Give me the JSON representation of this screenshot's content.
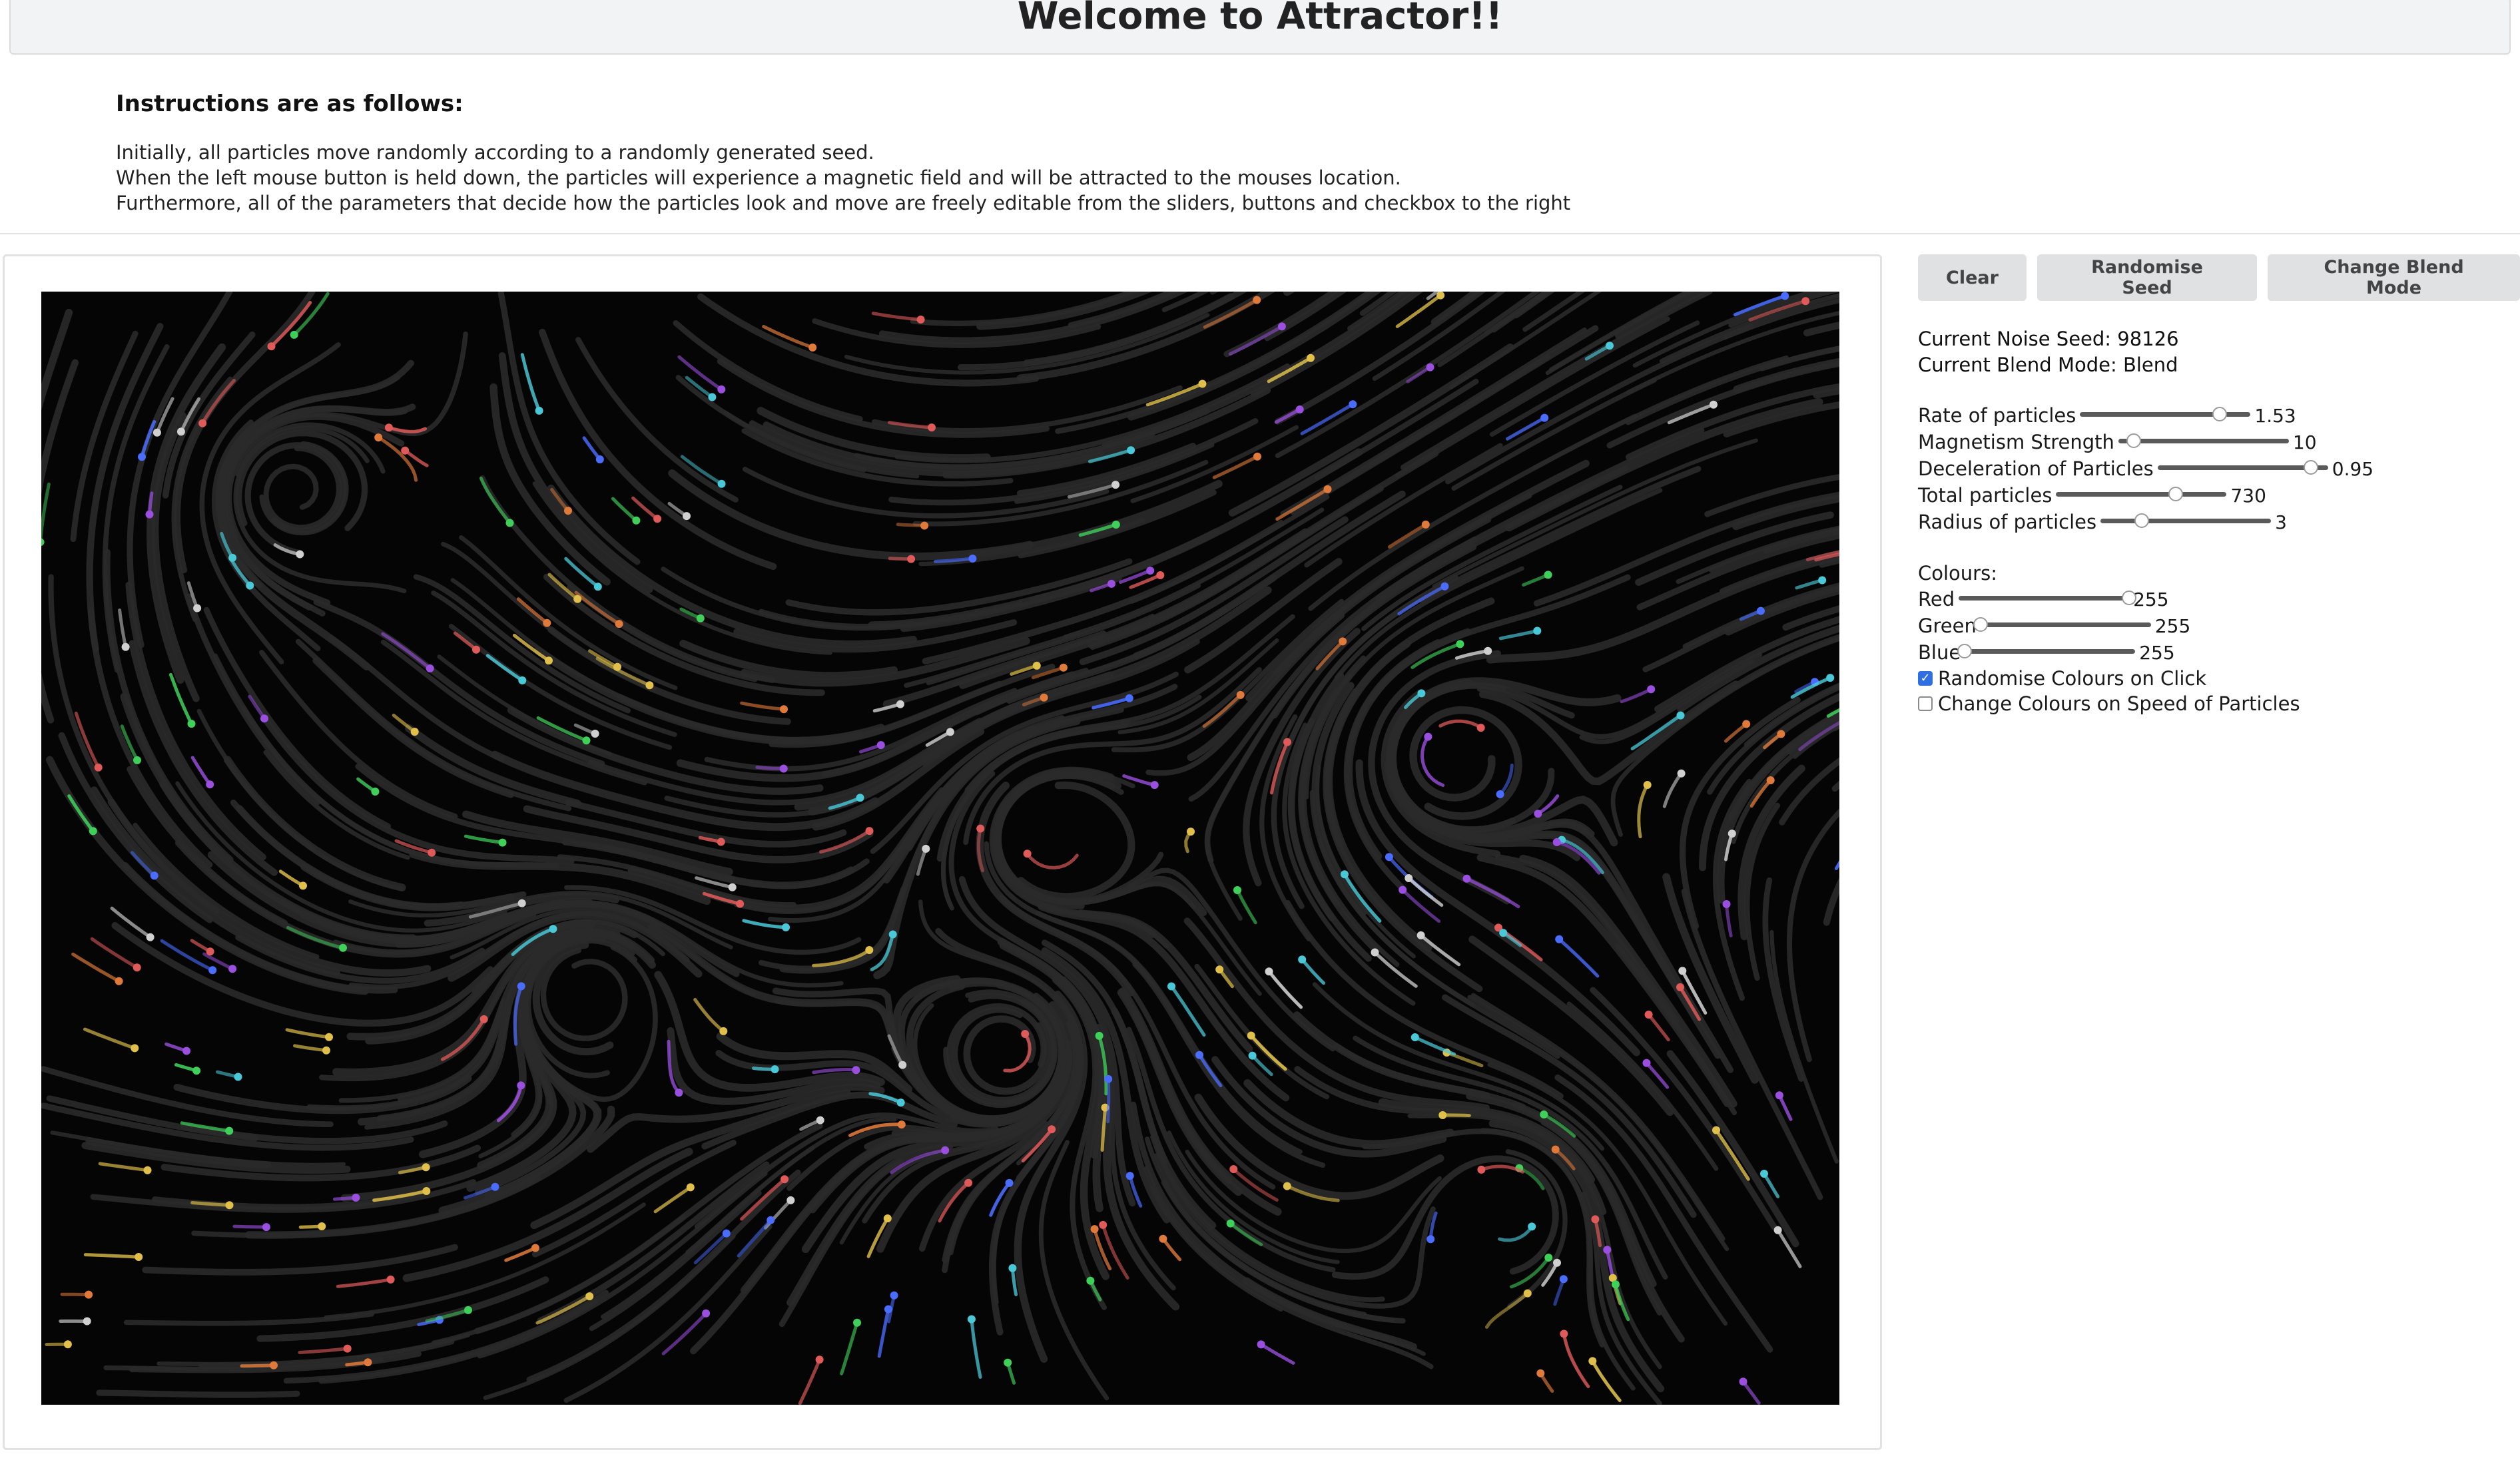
{
  "header": {
    "title": "Welcome to Attractor!!"
  },
  "instructions": {
    "heading": "Instructions are as follows:",
    "lines": [
      "Initially, all particles move randomly according to a randomly generated seed.",
      "When the left mouse button is held down, the particles will experience a magnetic field and will be attracted to the mouses location.",
      "Furthermore, all of the parameters that decide how the particles look and move are freely editable from the sliders, buttons and checkbox to the right"
    ]
  },
  "buttons": {
    "clear": "Clear",
    "randomise_seed": "Randomise Seed",
    "change_blend": "Change Blend Mode"
  },
  "info": {
    "noise_seed": "Current Noise Seed: 98126",
    "blend_mode": "Current Blend Mode: Blend"
  },
  "params": [
    {
      "label": "Rate of particles",
      "value": "1.53",
      "level": 0.82
    },
    {
      "label": "Magnetism Strength",
      "value": "10",
      "level": 0.09
    },
    {
      "label": "Deceleration of Particles",
      "value": "0.95",
      "level": 0.9
    },
    {
      "label": "Total particles",
      "value": "730",
      "level": 0.7
    },
    {
      "label": "Radius of particles",
      "value": "3",
      "level": 0.24
    }
  ],
  "colours": {
    "heading": "Colours:",
    "channels": [
      {
        "label": "Red",
        "value": "255",
        "level": 1.0
      },
      {
        "label": "Green",
        "value": "255",
        "level": 0.0
      },
      {
        "label": "Blue",
        "value": "255",
        "level": 0.0
      }
    ]
  },
  "checkboxes": [
    {
      "label": "Randomise Colours on Click",
      "checked": true
    },
    {
      "label": "Change Colours on Speed of Particles",
      "checked": false
    }
  ]
}
